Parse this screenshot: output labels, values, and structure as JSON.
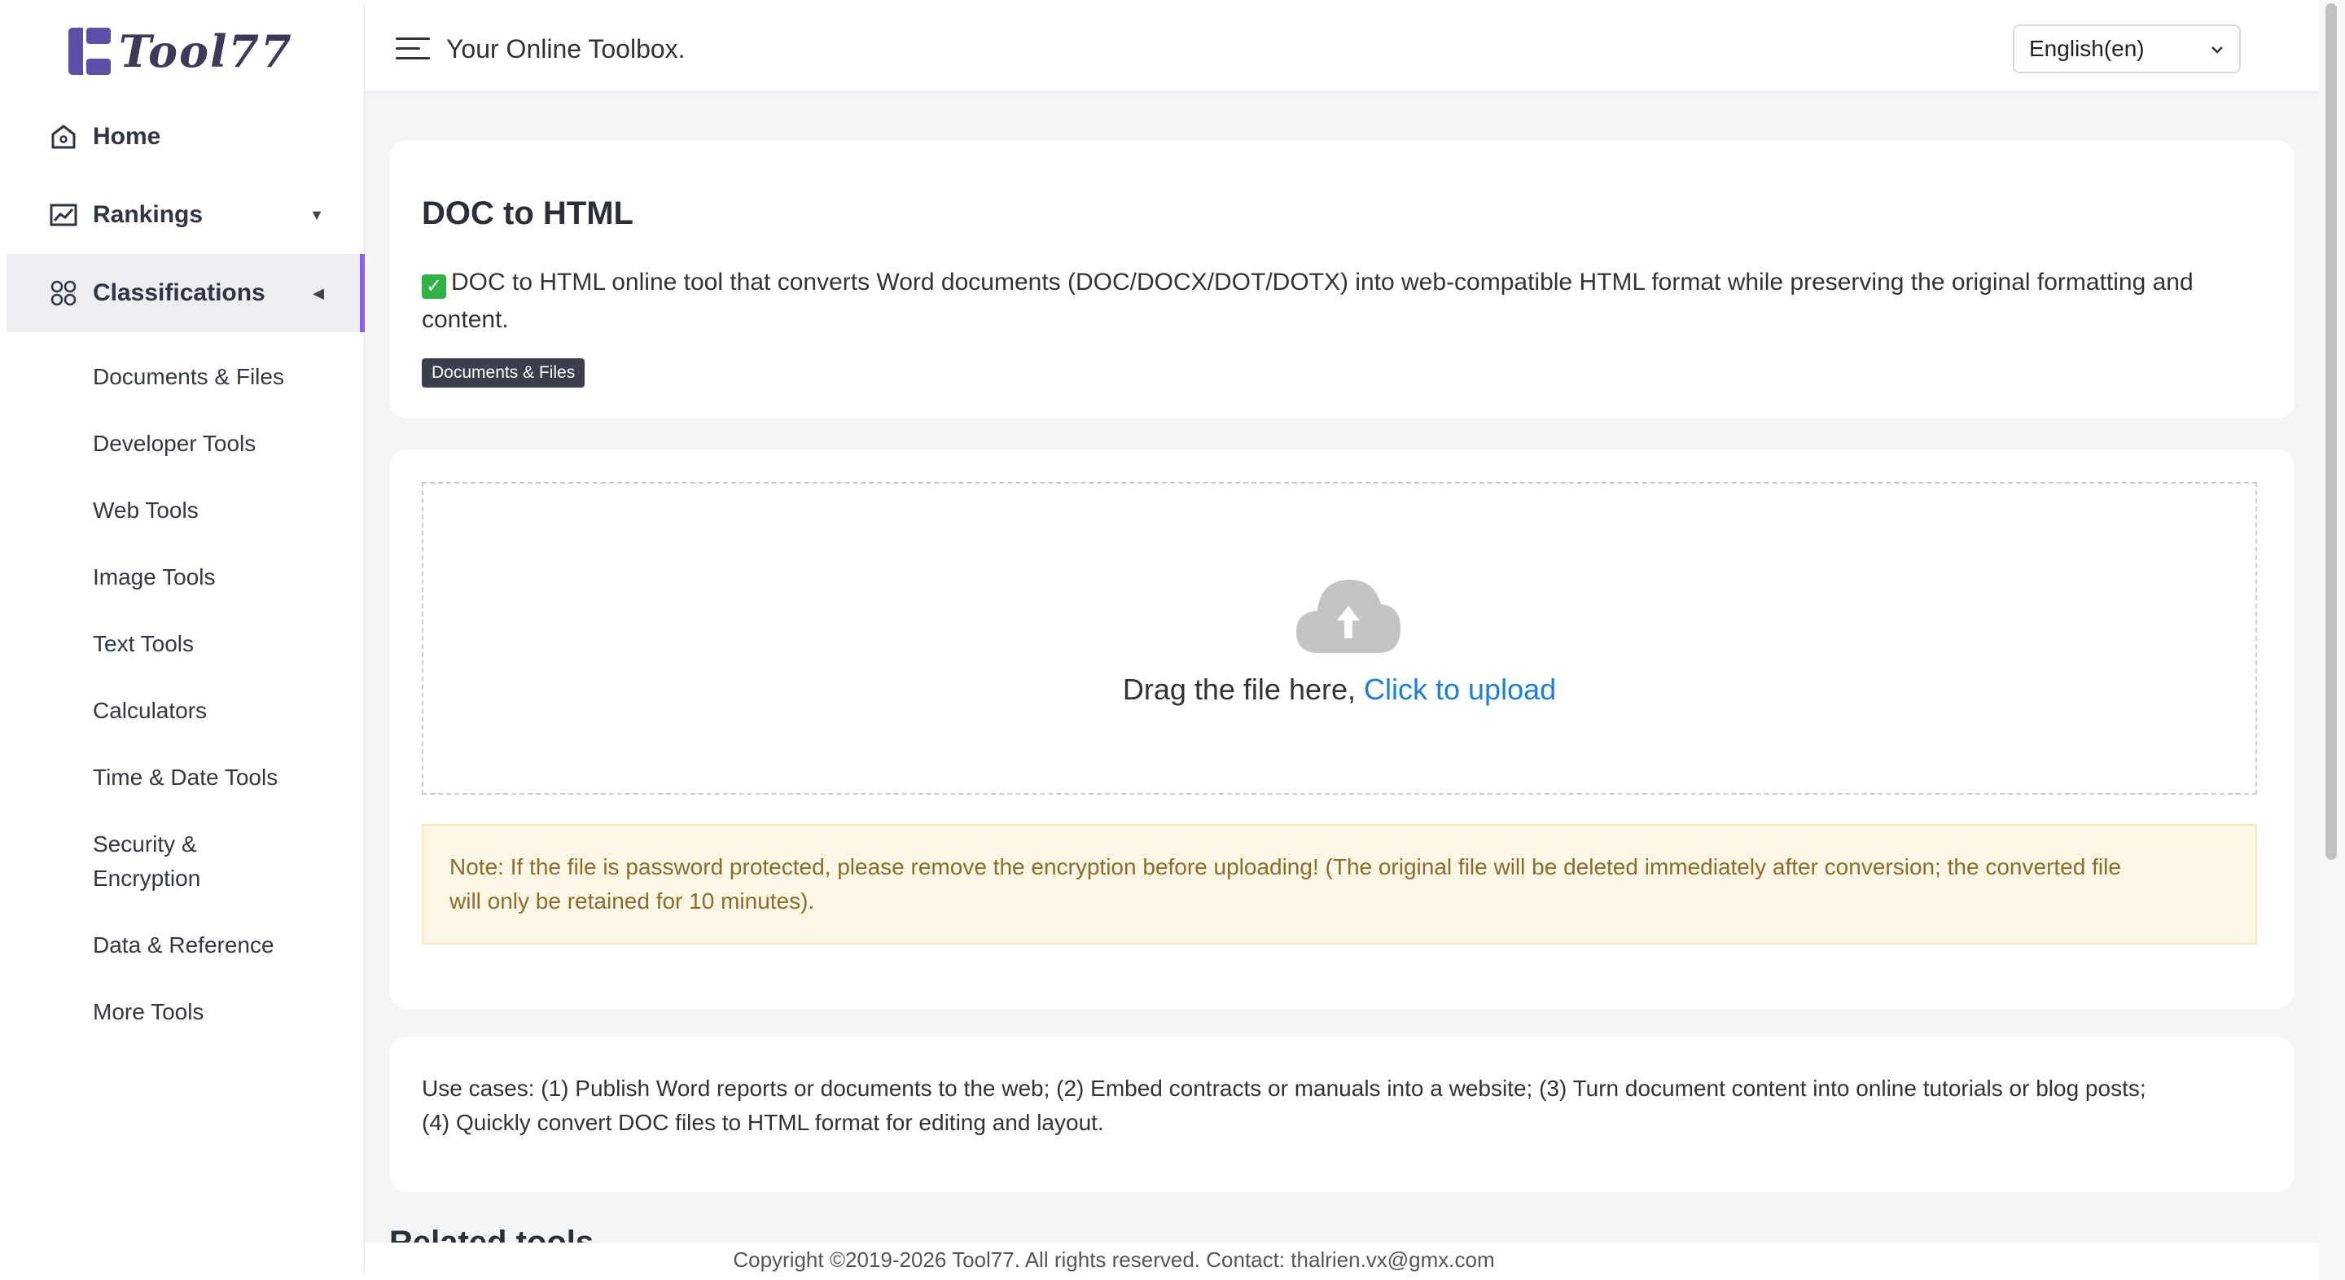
{
  "brand": {
    "name": "Tool77",
    "accent": "#8b5cf6",
    "logo_color": "#5b4fa8"
  },
  "header": {
    "tagline": "Your Online Toolbox.",
    "language": "English(en)"
  },
  "nav": {
    "home": "Home",
    "rankings": "Rankings",
    "classifications": "Classifications",
    "sub_items": [
      "Documents & Files",
      "Developer Tools",
      "Web Tools",
      "Image Tools",
      "Text Tools",
      "Calculators",
      "Time & Date Tools",
      "Security &",
      "Encryption",
      "Data & Reference",
      "More Tools"
    ]
  },
  "tool": {
    "title": "DOC to HTML",
    "description_line1": "DOC to HTML online tool that converts Word documents (DOC/DOCX/DOT/DOTX) into web-compatible HTML format while preserving the original formatting and",
    "description_line2": "content.",
    "tag": "Documents & Files"
  },
  "upload": {
    "drag_text": "Drag the file here, ",
    "click_text": "Click to upload",
    "note_line1": "Note: If the file is password protected, please remove the encryption before uploading! (The original file will be deleted immediately after conversion; the converted file",
    "note_line2": "will only be retained for 10 minutes)."
  },
  "usecases": {
    "line1": "Use cases: (1) Publish Word reports or documents to the web; (2) Embed contracts or manuals into a website; (3) Turn document content into online tutorials or blog posts;",
    "line2": "(4) Quickly convert DOC files to HTML format for editing and layout."
  },
  "related": {
    "heading": "Related tools"
  },
  "footer": {
    "copyright": "Copyright ©2019-2026 Tool77. All rights reserved. Contact: thalrien.vx@gmx.com"
  },
  "icons": [
    "home-icon",
    "chart-icon",
    "grid-icon",
    "hamburger-icon",
    "chevron-down-icon",
    "check-icon",
    "cloud-upload-icon"
  ]
}
